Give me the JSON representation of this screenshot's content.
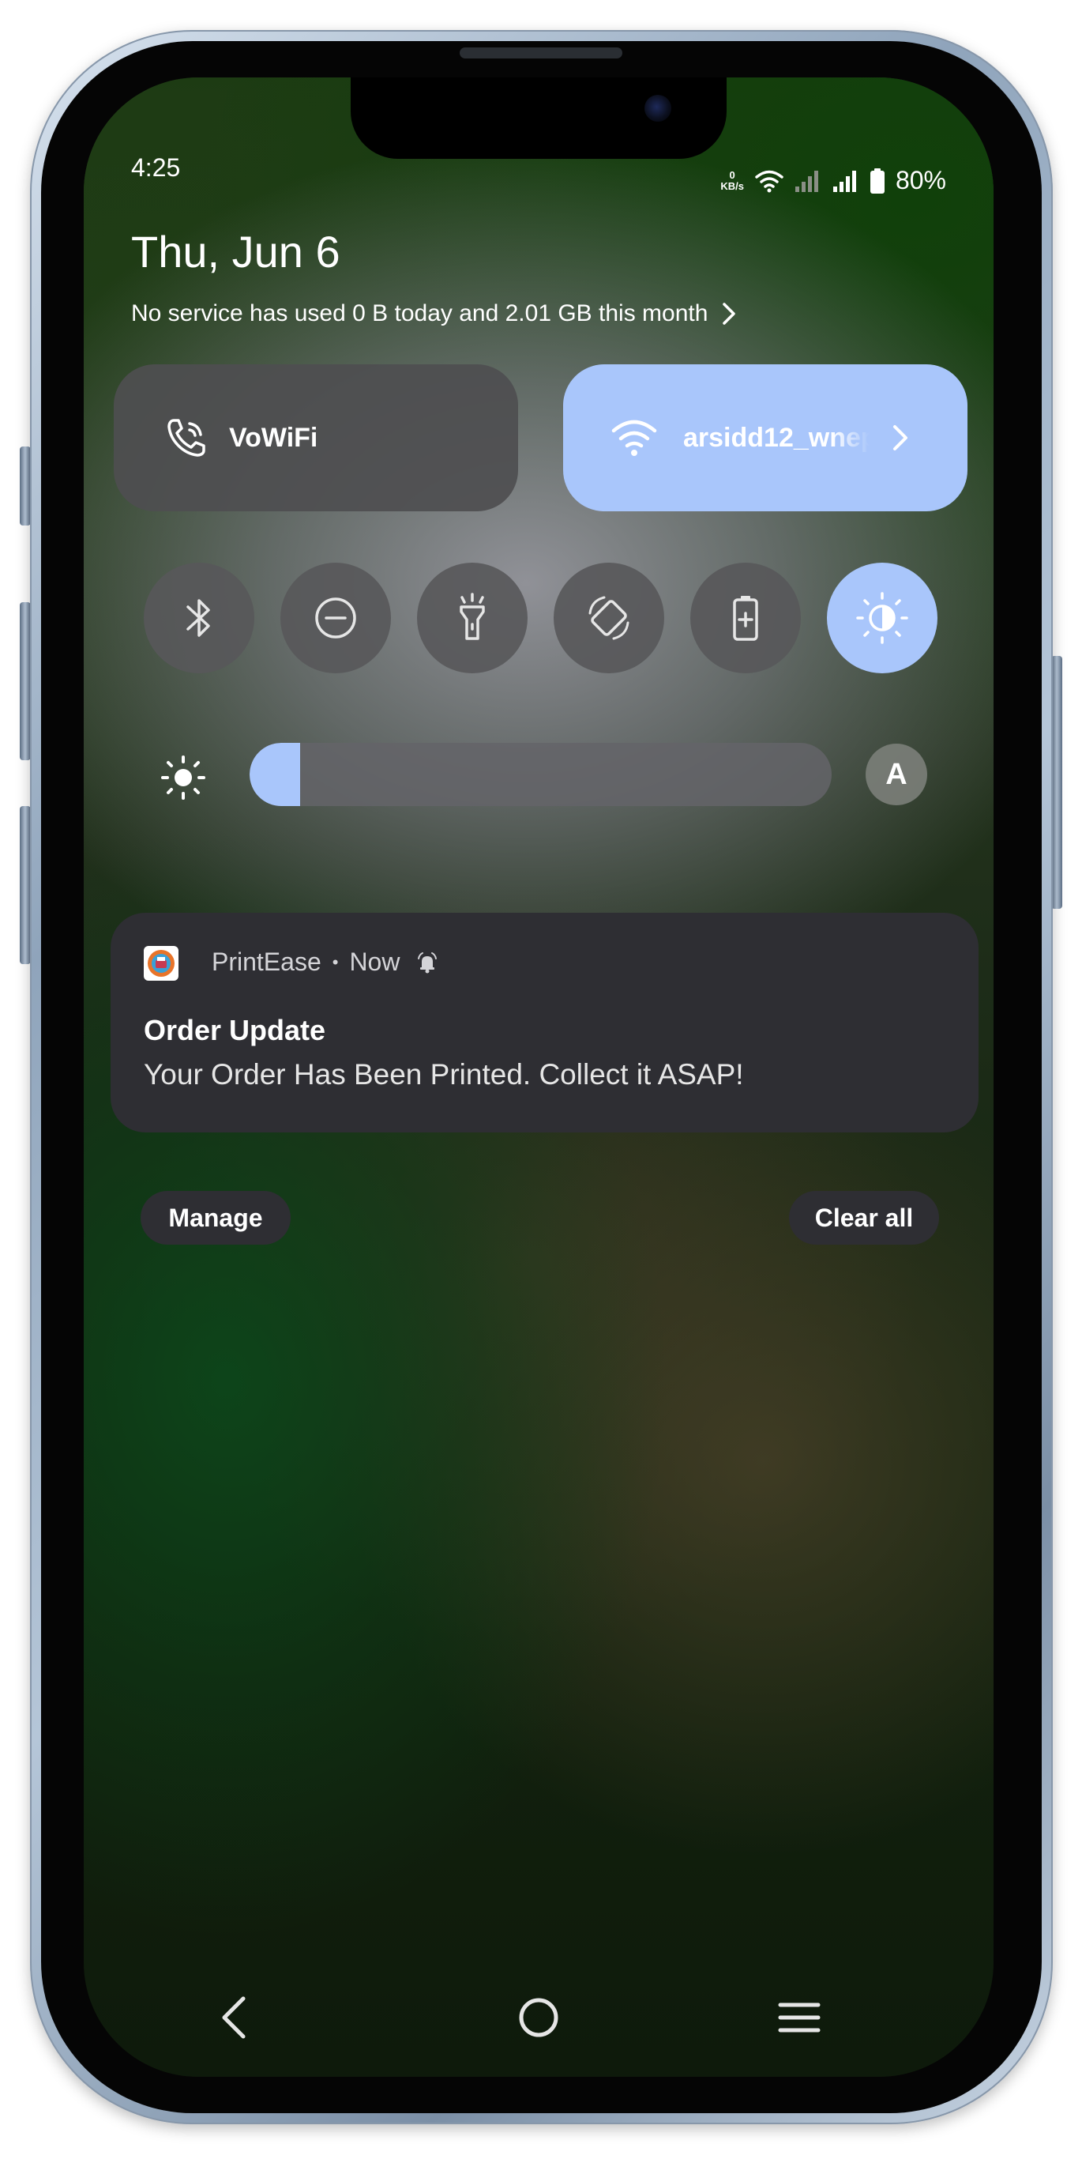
{
  "status_bar": {
    "time": "4:25",
    "net_speed_value": "0",
    "net_speed_unit": "KB/s",
    "battery": "80%"
  },
  "header": {
    "date": "Thu, Jun 6",
    "data_usage": "No service has used 0 B today and 2.01 GB this month"
  },
  "quick_tiles": {
    "vowifi": {
      "label": "VoWiFi",
      "icon": "wifi-calling-icon",
      "active": false
    },
    "wifi": {
      "label": "arsidd12_wnep",
      "icon": "wifi-icon",
      "active": true
    }
  },
  "toggles": [
    {
      "name": "bluetooth",
      "icon": "bluetooth-icon",
      "active": false
    },
    {
      "name": "do-not-disturb",
      "icon": "do-not-disturb-icon",
      "active": false
    },
    {
      "name": "flashlight",
      "icon": "flashlight-icon",
      "active": false
    },
    {
      "name": "auto-rotate",
      "icon": "rotate-icon",
      "active": false
    },
    {
      "name": "battery-saver",
      "icon": "battery-saver-icon",
      "active": false
    },
    {
      "name": "dark-theme",
      "icon": "contrast-icon",
      "active": true
    }
  ],
  "brightness": {
    "level_fraction": 0.05,
    "auto_label": "A"
  },
  "notification": {
    "app_name": "PrintEase",
    "separator": "•",
    "time": "Now",
    "title": "Order Update",
    "body": "Your Order Has Been Printed. Collect it ASAP!"
  },
  "actions": {
    "manage": "Manage",
    "clear_all": "Clear all"
  },
  "colors": {
    "accent": "#a9c6fb",
    "tile_inactive": "#4e4e50",
    "notification_bg": "#2e2e33"
  }
}
